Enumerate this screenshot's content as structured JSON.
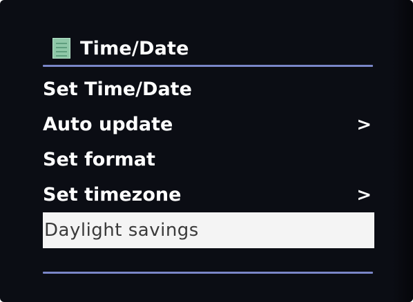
{
  "header": {
    "title": "Time/Date",
    "icon": "list-icon"
  },
  "menu": {
    "items": [
      {
        "label": "Set Time/Date",
        "arrow": ""
      },
      {
        "label": "Auto update",
        "arrow": ">"
      },
      {
        "label": "Set format",
        "arrow": ""
      },
      {
        "label": "Set timezone",
        "arrow": ">"
      },
      {
        "label": "Daylight savings",
        "arrow": "",
        "selected": true
      }
    ]
  },
  "colors": {
    "background": "#0b0d14",
    "text": "#ffffff",
    "rule": "#7a86c8",
    "selected_background": "#f4f4f4",
    "selected_text": "#3a3a3a",
    "icon": "#8fc7a8"
  }
}
